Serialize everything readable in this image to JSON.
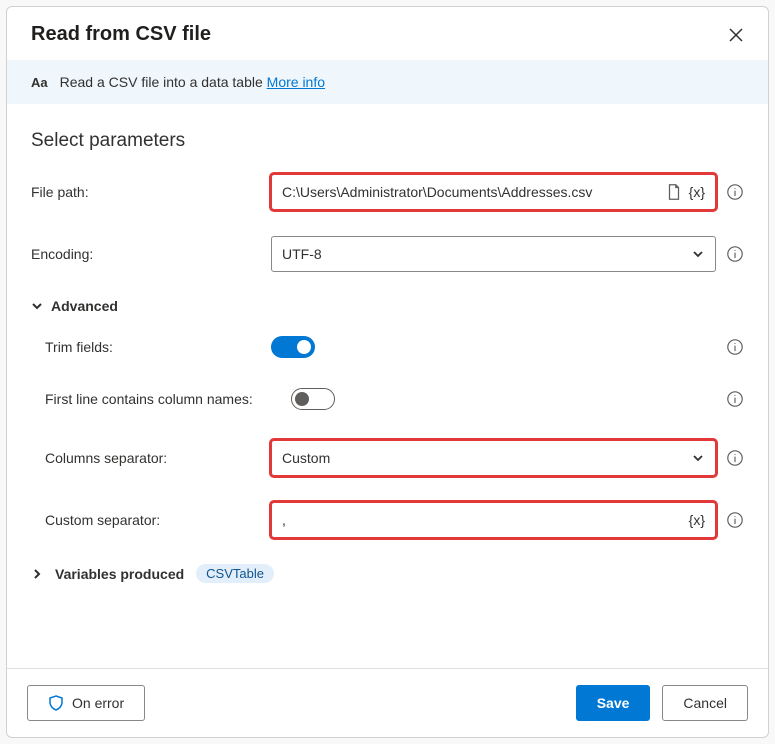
{
  "dialog": {
    "title": "Read from CSV file"
  },
  "banner": {
    "description": "Read a CSV file into a data table",
    "more_info": "More info"
  },
  "params": {
    "heading": "Select parameters",
    "file_path_label": "File path:",
    "file_path_value": "C:\\Users\\Administrator\\Documents\\Addresses.csv",
    "encoding_label": "Encoding:",
    "encoding_value": "UTF-8",
    "advanced_label": "Advanced",
    "trim_fields_label": "Trim fields:",
    "trim_fields_on": true,
    "first_line_label": "First line contains column names:",
    "first_line_on": false,
    "columns_sep_label": "Columns separator:",
    "columns_sep_value": "Custom",
    "custom_sep_label": "Custom separator:",
    "custom_sep_value": ",",
    "vars_produced_label": "Variables produced",
    "vars_produced_pill": "CSVTable",
    "var_token": "{x}"
  },
  "footer": {
    "on_error": "On error",
    "save": "Save",
    "cancel": "Cancel"
  }
}
